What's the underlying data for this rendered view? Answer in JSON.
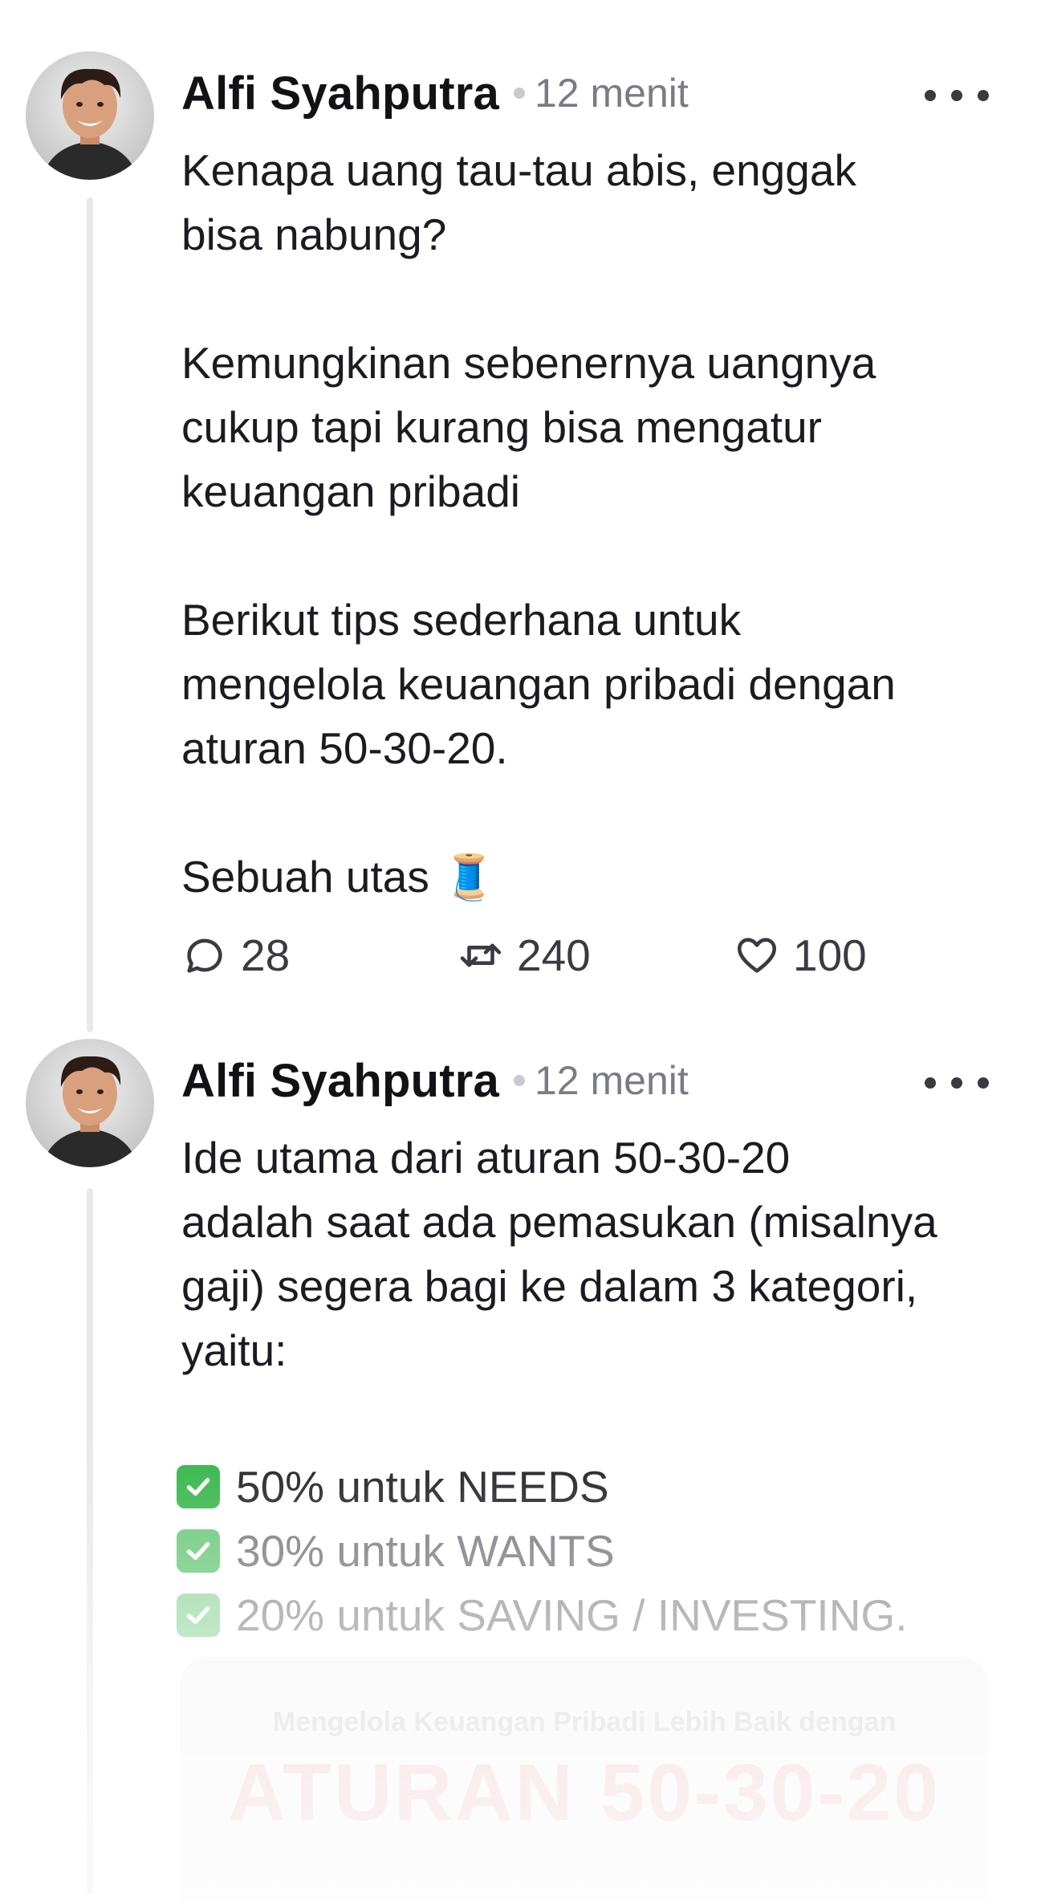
{
  "posts": [
    {
      "author": "Alfi Syahputra",
      "time": "12 menit",
      "text": "Kenapa uang tau-tau abis, enggak\nbisa nabung?\n\nKemungkinan sebenernya uangnya\ncukup tapi kurang bisa mengatur\nkeuangan pribadi\n\nBerikut tips sederhana untuk\nmengelola keuangan pribadi dengan\naturan 50-30-20.\n\nSebuah utas 🧵",
      "stats": {
        "replies": "28",
        "reposts": "240",
        "likes": "100"
      }
    },
    {
      "author": "Alfi Syahputra",
      "time": "12 menit",
      "text": "Ide utama dari aturan 50-30-20\nadalah saat ada pemasukan (misalnya\ngaji) segera bagi ke dalam 3 kategori,\nyaitu:",
      "checklist": [
        "50% untuk NEEDS",
        "30% untuk WANTS",
        "20% untuk SAVING / INVESTING."
      ],
      "media": {
        "subtitle": "Mengelola Keuangan Pribadi Lebih Baik dengan",
        "title": "ATURAN 50-30-20"
      }
    }
  ],
  "icons": {
    "more": "more-horizontal-icon",
    "reply": "speech-bubble-icon",
    "repost": "repost-arrows-icon",
    "like": "heart-icon",
    "check": "check-mark-box-icon"
  },
  "colors": {
    "check_green": "#2fb344",
    "thread_line": "#e8e8ea",
    "muted_text": "#7b7b85"
  }
}
